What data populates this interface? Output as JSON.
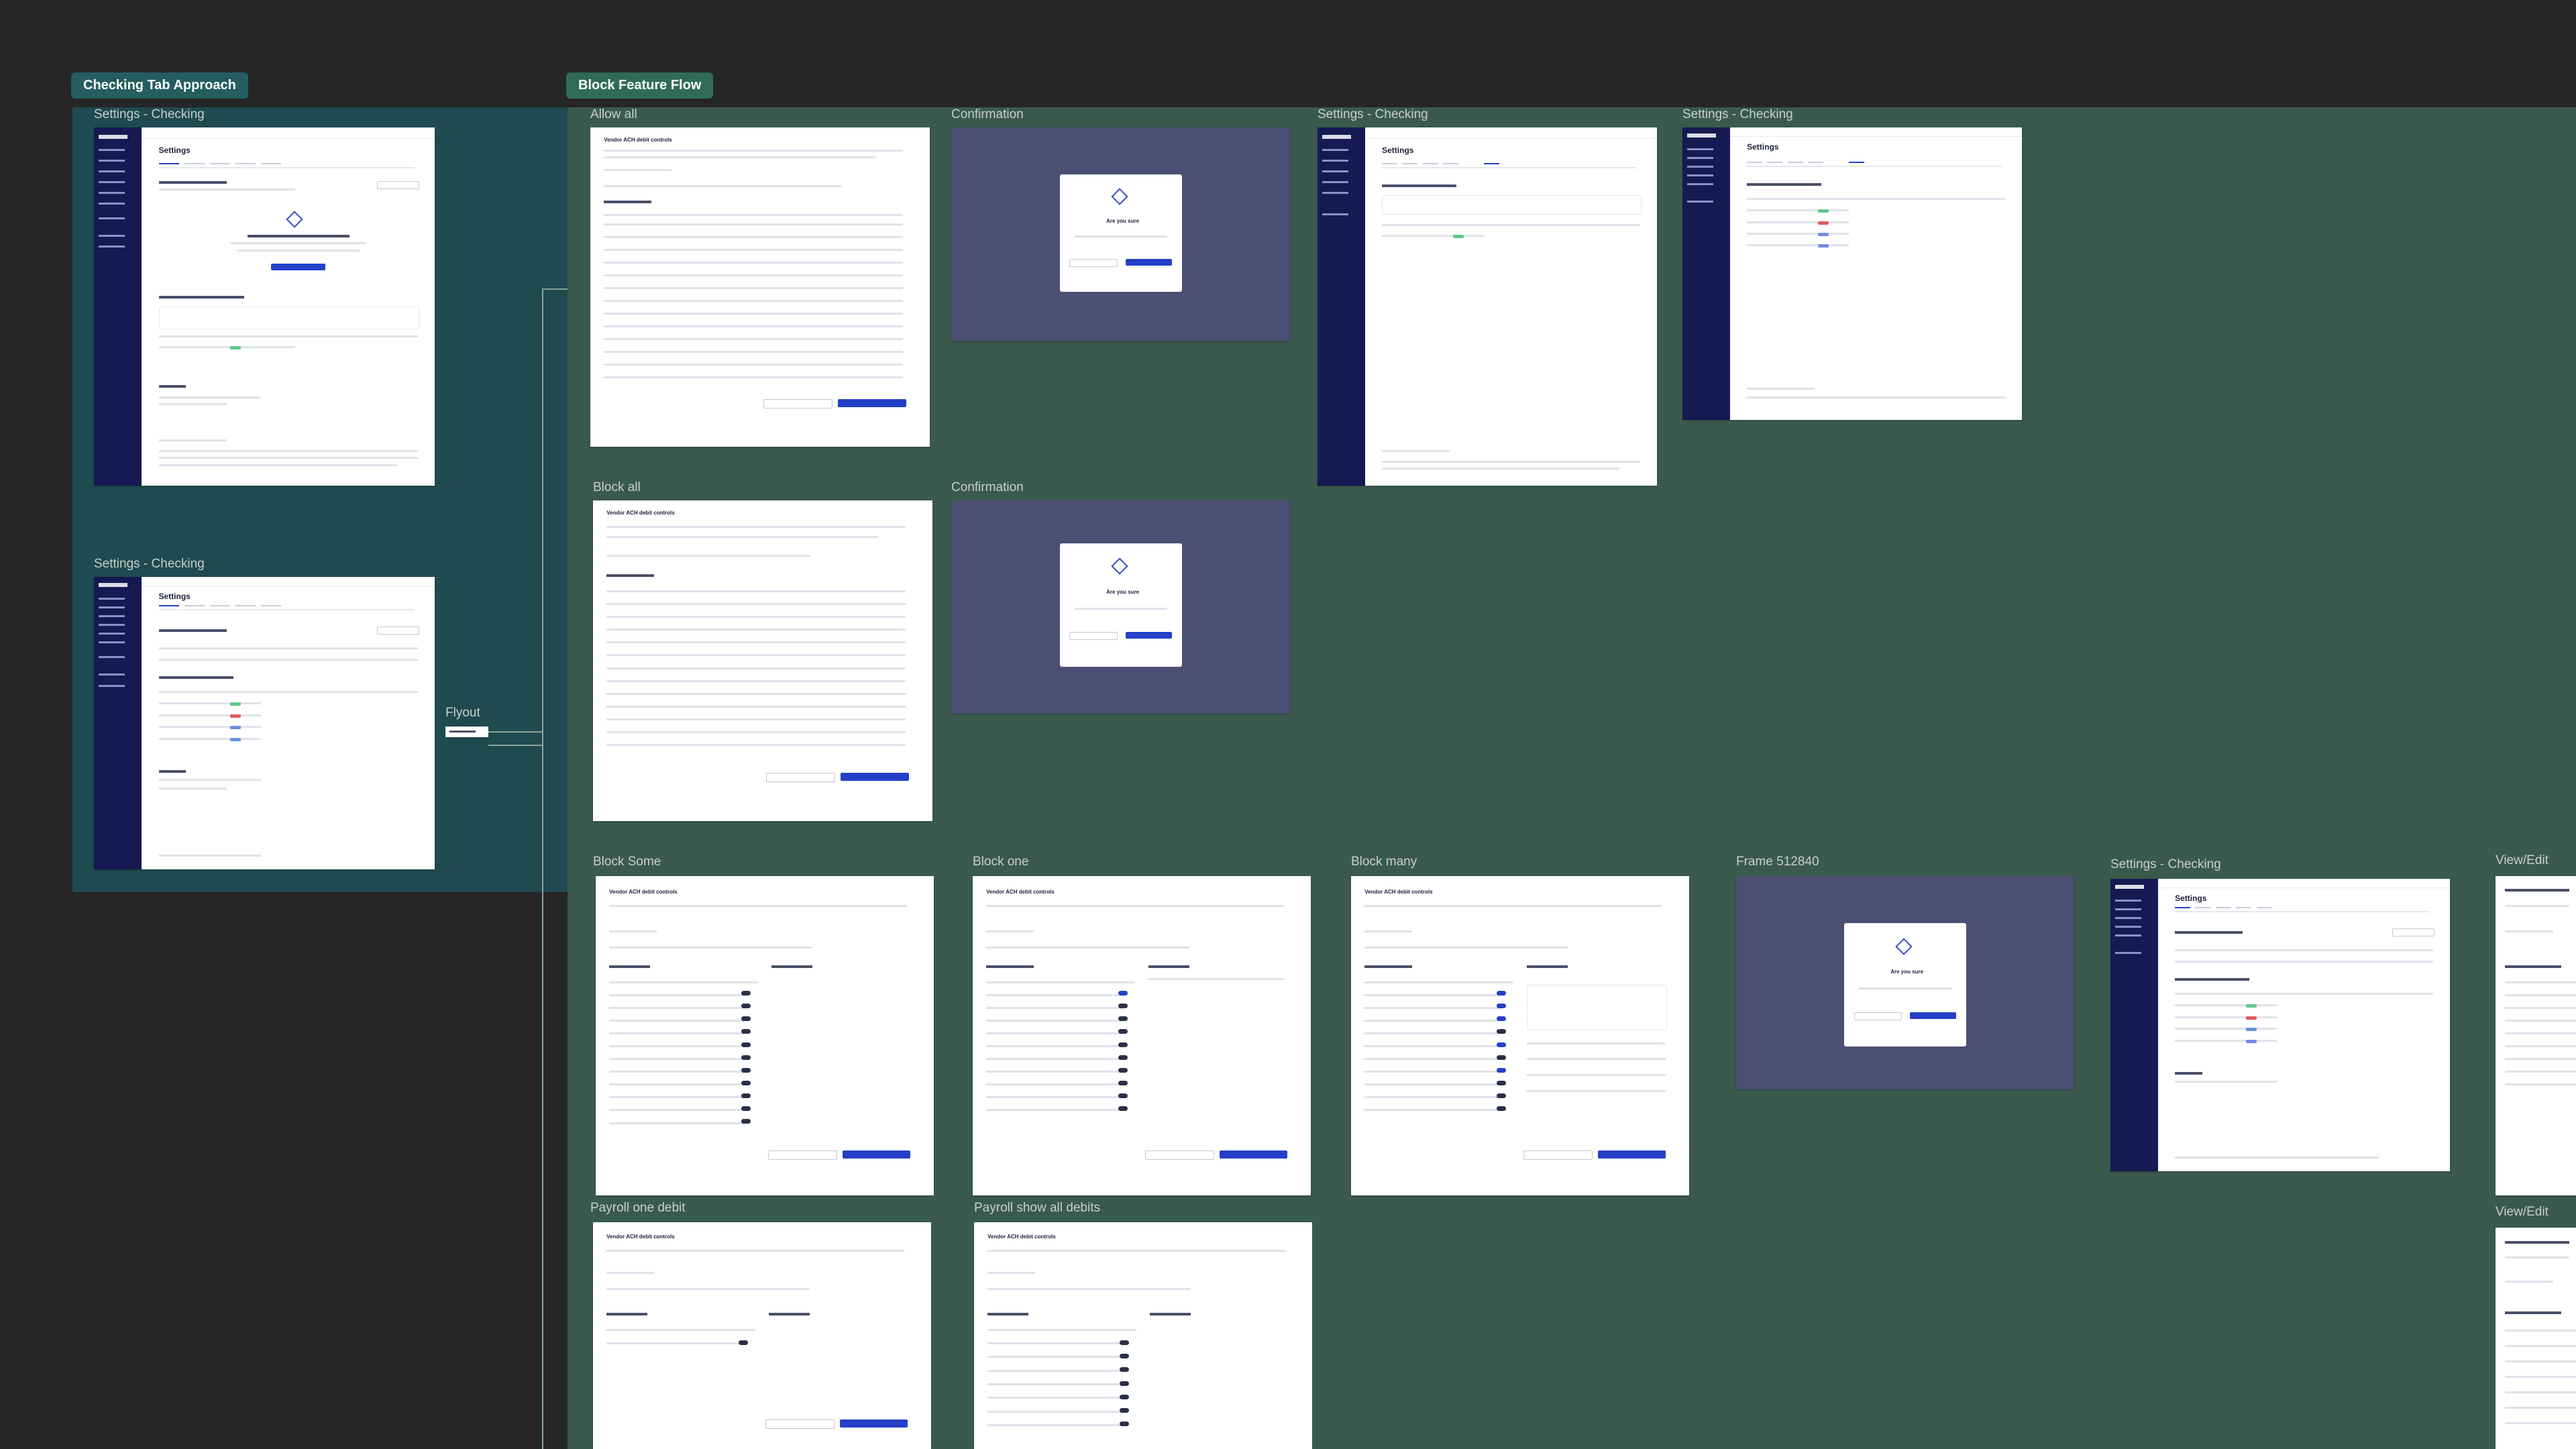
{
  "sections": {
    "checking_tab": {
      "label": "Checking Tab Approach",
      "bg": "#1f4a4f",
      "tag_bg": "#245e5f"
    },
    "block_feature": {
      "label": "Block Feature Flow",
      "bg": "#3a5a4d",
      "tag_bg": "#2f6b55"
    }
  },
  "frames": {
    "settings_a": {
      "label": "Settings - Checking",
      "app_name": "bluevine",
      "title": "Settings"
    },
    "settings_b": {
      "label": "Settings - Checking",
      "app_name": "bluevine",
      "title": "Settings"
    },
    "flyout": {
      "label": "Flyout"
    },
    "allow_all": {
      "label": "Allow all",
      "title": "Vendor ACH debit controls"
    },
    "confirm_1": {
      "label": "Confirmation",
      "modal_title": "Are you sure"
    },
    "settings_c": {
      "label": "Settings - Checking",
      "title": "Settings"
    },
    "settings_d": {
      "label": "Settings - Checking",
      "title": "Settings"
    },
    "block_all": {
      "label": "Block all",
      "title": "Vendor ACH debit controls"
    },
    "confirm_2": {
      "label": "Confirmation",
      "modal_title": "Are you sure"
    },
    "block_some": {
      "label": "Block Some",
      "title": "Vendor ACH debit controls"
    },
    "block_one": {
      "label": "Block one",
      "title": "Vendor ACH debit controls"
    },
    "block_many": {
      "label": "Block many",
      "title": "Vendor ACH debit controls"
    },
    "frame_512840": {
      "label": "Frame 512840",
      "modal_title": "Are you sure"
    },
    "settings_e": {
      "label": "Settings - Checking",
      "title": "Settings"
    },
    "view_edit_1": {
      "label": "View/Edit"
    },
    "payroll_one": {
      "label": "Payroll one debit",
      "title": "Vendor ACH debit controls"
    },
    "payroll_all": {
      "label": "Payroll show all debits",
      "title": "Vendor ACH debit controls"
    },
    "view_edit_2": {
      "label": "View/Edit"
    }
  },
  "colors": {
    "canvas": "#262626",
    "sidebar": "#151a52",
    "primary": "#2440c9",
    "dim_overlay": "#4a4f73"
  },
  "icons": [
    "diamond-icon",
    "close-icon"
  ]
}
